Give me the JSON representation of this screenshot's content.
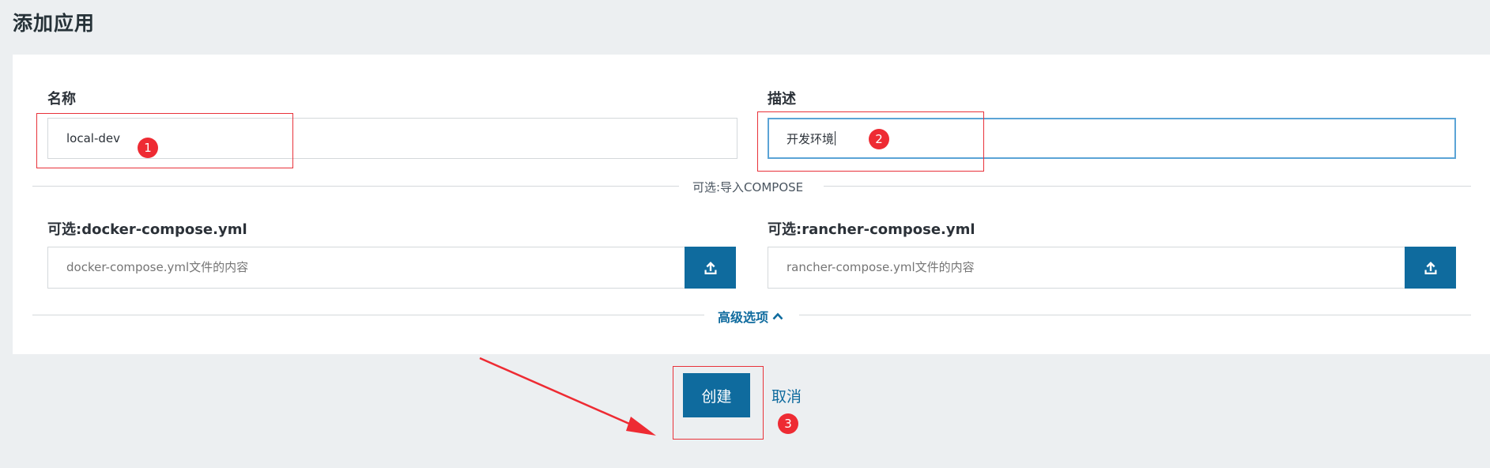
{
  "page": {
    "title": "添加应用"
  },
  "form": {
    "name": {
      "label": "名称",
      "value": "local-dev"
    },
    "description": {
      "label": "描述",
      "value": "开发环境"
    },
    "compose_divider": "可选:导入COMPOSE",
    "docker_compose": {
      "label": "可选:docker-compose.yml",
      "placeholder": "docker-compose.yml文件的内容",
      "upload_icon": "upload-icon"
    },
    "rancher_compose": {
      "label": "可选:rancher-compose.yml",
      "placeholder": "rancher-compose.yml文件的内容",
      "upload_icon": "upload-icon"
    },
    "advanced_options": {
      "label": "高级选项",
      "icon": "chevron-up-icon"
    }
  },
  "actions": {
    "create_label": "创建",
    "cancel_label": "取消"
  },
  "annotations": {
    "markers": [
      "1",
      "2",
      "3"
    ],
    "color": "#e8323a"
  },
  "colors": {
    "primary": "#0f6b9e",
    "background": "#eceff1",
    "card": "#ffffff",
    "focus_border": "#5ba4d6"
  }
}
